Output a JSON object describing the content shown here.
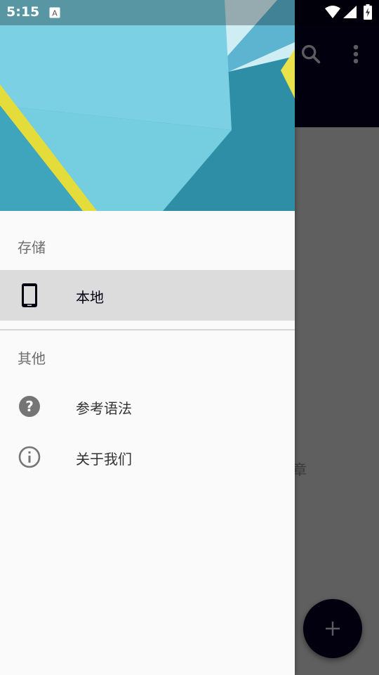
{
  "status_bar": {
    "time": "5:15",
    "notification_icon": "keyboard-a-icon",
    "wifi_icon": "wifi-icon",
    "signal_icon": "cell-signal-icon",
    "battery_icon": "battery-charging-icon"
  },
  "app": {
    "toolbar_color": "#02000f",
    "actions": [
      {
        "name": "search",
        "icon": "search-icon"
      },
      {
        "name": "more",
        "icon": "more-vert-icon"
      }
    ],
    "partial_text": "章",
    "fab_icon": "plus-icon"
  },
  "drawer": {
    "sections": [
      {
        "label": "存储",
        "items": [
          {
            "label": "本地",
            "icon": "smartphone-icon",
            "selected": true
          }
        ]
      },
      {
        "label": "其他",
        "items": [
          {
            "label": "参考语法",
            "icon": "help-circle-icon",
            "selected": false
          },
          {
            "label": "关于我们",
            "icon": "info-circle-icon",
            "selected": false
          }
        ]
      }
    ]
  },
  "colors": {
    "selected_bg": "#dcdcdc",
    "drawer_bg": "#fafafa",
    "icon_gray": "#757575",
    "primary_dark": "#02000f"
  }
}
